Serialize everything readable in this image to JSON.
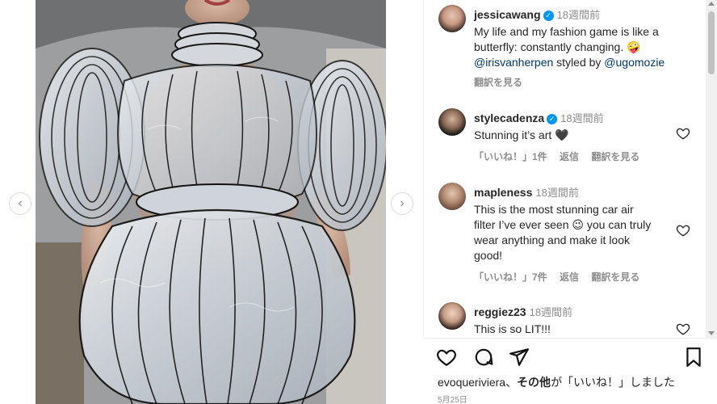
{
  "post": {
    "author": "jessicawang",
    "time": "18週間前",
    "caption_line1": "My life and my fashion game is like a",
    "caption_line2": "butterfly: constantly changing. 🤪",
    "mention1": "@irisvanherpen",
    "styled_by": " styled by ",
    "mention2": "@ugomozie",
    "translate": "翻訳を見る"
  },
  "comments": [
    {
      "user": "stylecadenza",
      "verified": true,
      "time": "18週間前",
      "lines": [
        "Stunning it’s art 🖤"
      ],
      "likes": "「いいね！」1件",
      "reply": "返信",
      "translate": "翻訳を見る"
    },
    {
      "user": "mapleness",
      "verified": false,
      "time": "18週間前",
      "lines": [
        "This is the most stunning car air",
        "filter I’ve ever seen 😉 you can truly",
        "wear anything and make it look",
        "good!"
      ],
      "likes": "「いいね！」7件",
      "reply": "返信",
      "translate": "翻訳を見る"
    },
    {
      "user": "reggiez23",
      "verified": false,
      "time": "18週間前",
      "lines": [
        "This is so LIT!!!"
      ]
    }
  ],
  "footer": {
    "liked_user": "evoqueriviera",
    "liked_mid": "、",
    "liked_others": "その他",
    "liked_tail": "が「いいね！」しました",
    "date": "5月25日"
  },
  "icons": {
    "prev": "chevron-left-icon",
    "next": "chevron-right-icon",
    "like": "heart-icon",
    "comment": "comment-icon",
    "share": "share-icon",
    "save": "bookmark-icon"
  },
  "colors": {
    "verified": "#0095f6",
    "link": "#00376b",
    "muted": "#8e8e8e"
  }
}
